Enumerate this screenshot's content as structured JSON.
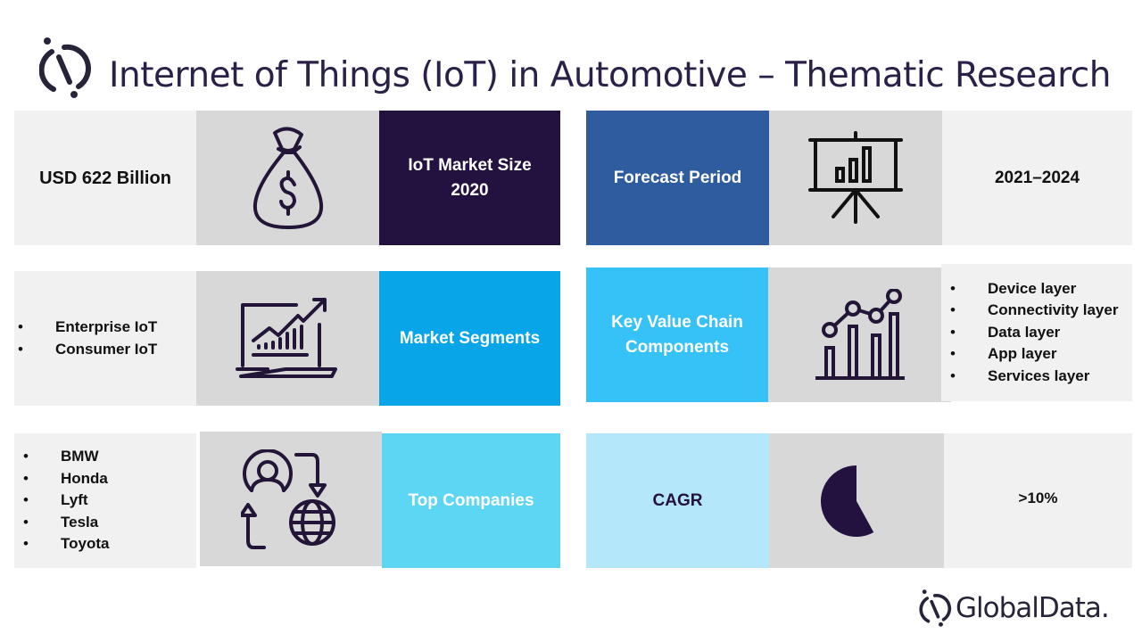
{
  "header": {
    "title": "Internet of Things (IoT) in Automotive – Thematic Research",
    "logo_icon": "globaldata-logo-icon"
  },
  "colors": {
    "dark_purple": "#231240",
    "royal_blue": "#2f5c9e",
    "bright_blue": "#08a6e8",
    "sky_blue": "#36c2f6",
    "cyan": "#5dd6f4",
    "pale_blue": "#b5e7fb",
    "icon_stroke": "#221538"
  },
  "tiles": {
    "market_size": {
      "value": "USD 622 Billion",
      "icon": "money-bag-icon",
      "label_line1": "IoT Market Size",
      "label_line2": "2020"
    },
    "forecast": {
      "label": "Forecast Period",
      "icon": "presentation-chart-icon",
      "value": "2021–2024"
    },
    "segments": {
      "items": [
        "Enterprise IoT",
        "Consumer IoT"
      ],
      "icon": "laptop-growth-chart-icon",
      "label": "Market Segments"
    },
    "value_chain": {
      "label_line1": "Key Value Chain",
      "label_line2": "Components",
      "icon": "bar-line-chart-icon",
      "items": [
        "Device layer",
        "Connectivity layer",
        "Data layer",
        "App layer",
        "Services layer"
      ]
    },
    "companies": {
      "items": [
        "BMW",
        "Honda",
        "Lyft",
        "Tesla",
        "Toyota"
      ],
      "icon": "user-globe-exchange-icon",
      "label": "Top Companies"
    },
    "cagr": {
      "label": "CAGR",
      "icon": "pie-slice-icon",
      "pie_fraction": 0.58,
      "value": ">10%"
    }
  },
  "footer": {
    "brand": "GlobalData.",
    "logo_icon": "globaldata-logo-icon"
  }
}
